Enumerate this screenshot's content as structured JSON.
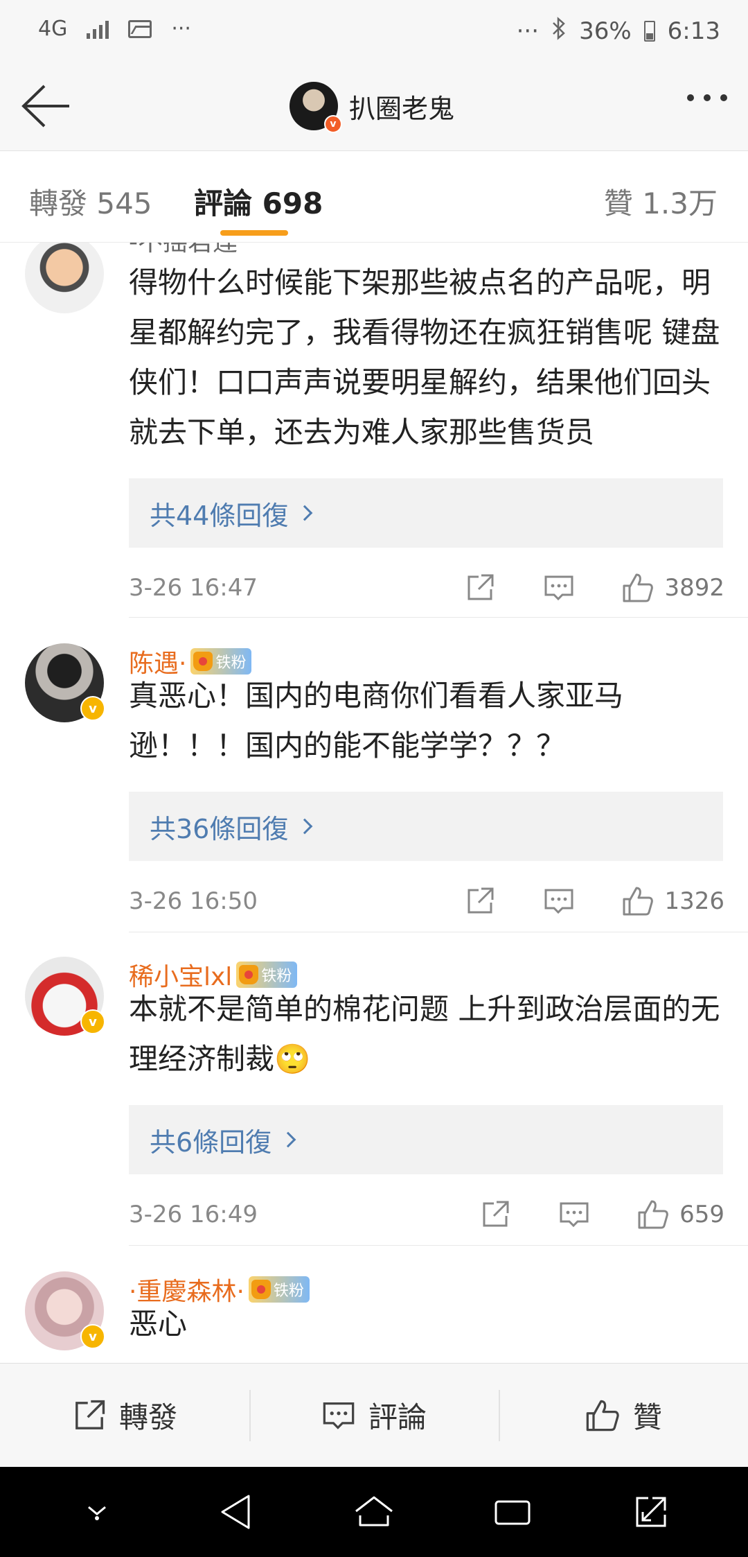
{
  "status_bar": {
    "network": "4G",
    "overflow_left": "···",
    "overflow_right": "···",
    "battery": "36%",
    "time": "6:13"
  },
  "header": {
    "title": "扒圈老鬼",
    "back_icon": "arrow-left-icon",
    "more_icon": "ellipsis-icon"
  },
  "tabs": {
    "repost": "轉發 545",
    "comment": "評論 698",
    "like": "贊 1.3万",
    "active_color": "#f79e1b"
  },
  "comments": [
    {
      "name": "-不摇君莲",
      "text": "得物什么时候能下架那些被点名的产品呢，明星都解约完了，我看得物还在疯狂销售呢 键盘侠们！口口声声说要明星解约，结果他们回头就去下单，还去为难人家那些售货员",
      "replies": "共44條回復",
      "time": "3-26 16:47",
      "likes": "3892"
    },
    {
      "name": "陈遇·",
      "badge": "铁粉",
      "text": "真恶心！国内的电商你们看看人家亚马逊！！！国内的能不能学学？？？",
      "replies": "共36條回復",
      "time": "3-26 16:50",
      "likes": "1326"
    },
    {
      "name": "稀小宝lxl",
      "badge": "铁粉",
      "text": "本就不是简单的棉花问题 上升到政治层面的无理经济制裁🙄",
      "replies": "共6條回復",
      "time": "3-26 16:49",
      "likes": "659"
    },
    {
      "name": "·重慶森林·",
      "badge": "铁粉",
      "text": "恶心"
    }
  ],
  "bottom_bar": {
    "repost": "轉發",
    "comment": "評論",
    "like": "贊"
  },
  "colors": {
    "username": "#e86c1e",
    "link": "#4f7cb0",
    "verified": "#f7b500"
  }
}
